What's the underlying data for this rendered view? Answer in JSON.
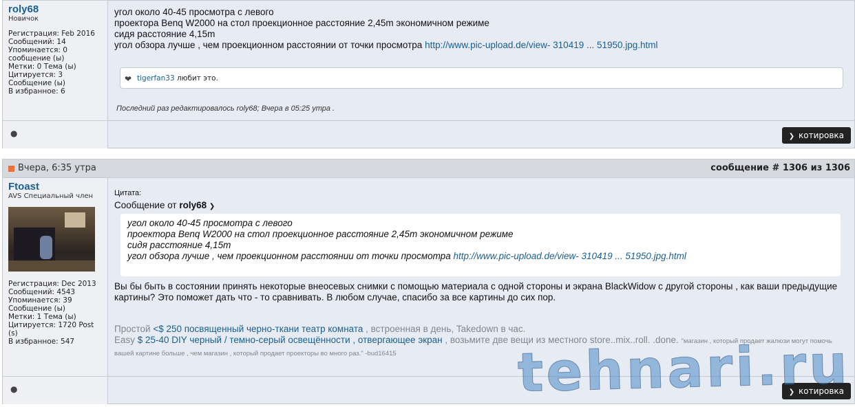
{
  "post1": {
    "username": "roly68",
    "usertitle": "Новичок",
    "stats": [
      "Регистрация: Feb 2016",
      "Сообщений: 14",
      "Упоминается: 0",
      "сообщение (ы)",
      "Метки: 0 Тема (ы)",
      "Цитируется: 3",
      "Сообщение (ы)",
      "В избранное: 6"
    ],
    "lines": [
      "угол около 40-45 просмотра с левого",
      "проектора Benq W2000 на стол проекционное расстояние 2,45m экономичном режиме",
      "сидя расстояние 4,15m"
    ],
    "last_line_text": "угол обзора лучше , чем проекционном расстоянии от точки просмотра ",
    "link": "http://www.pic-upload.de/view- 310419 ... 51950.jpg.html",
    "like_user": "tigerfan33",
    "like_text": " любит это.",
    "edited": "Последний раз редактировалось roly68; Вчера в 05:25 утра .",
    "quote_button": "котировка"
  },
  "post2": {
    "date": "Вчера, 6:35 утра",
    "post_number": "сообщение # 1306 из 1306",
    "username": "Ftoast",
    "usertitle": "AVS Специальный член",
    "stats": [
      "Регистрация: Dec 2013",
      "Сообщений: 4543",
      "Упоминается: 39",
      "Сообщение (ы)",
      "Метки: 1 Тема (ы)",
      "Цитируется: 1720 Post",
      "(s)",
      "В избранное: 547"
    ],
    "quote_label": "Цитата:",
    "quote_from_prefix": "Сообщение от ",
    "quote_from_user": "roly68",
    "quote_lines": [
      "угол около 40-45 просмотра с левого",
      "проектора Benq W2000 на стол проекционное расстояние 2,45m экономичном режиме",
      "сидя расстояние 4,15m"
    ],
    "quote_last_text": "угол обзора лучше , чем проекционном расстоянии от точки просмотра ",
    "quote_link": "http://www.pic-upload.de/view- 310419 ... 51950.jpg.html",
    "reply": "Вы бы быть в состоянии принять некоторые внеосевых снимки с помощью материала с одной стороны и экрана BlackWidow с другой стороны , как ваши предыдущие картины? Это поможет дать что - то сравнивать. В любом случае, спасибо за все картины до сих пор.",
    "sig1_prefix": "Простой ",
    "sig1_link": "<$ 250 посвященный черно-ткани театр комната",
    "sig1_suffix": " , встроенная в день, Takedown в час.",
    "sig2_prefix": "Easy ",
    "sig2_link": "$ 25-40 DIY черный / темно-серый освещённости , отвергающее экран",
    "sig2_suffix": " , возьмите две вещи из местного store..mix..roll. .done. ",
    "sig2_small": "\"магазин , который продает жалюзи могут помочь вашей картине больше , чем магазин , который продает проекторы во много раз.\" -bud16415",
    "quote_button": "котировка"
  },
  "watermark": "tehnari.ru",
  "colors": {
    "accent_link": "#1a5f8f",
    "header_bullet": "#e8733a",
    "button_bg": "#222222"
  }
}
